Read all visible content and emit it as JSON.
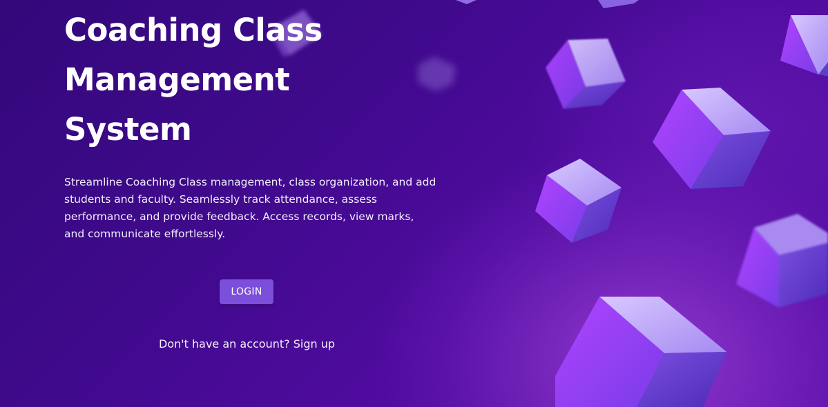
{
  "hero": {
    "title_line1": "Coaching Class",
    "title_line2": "Management",
    "title_line3": "System",
    "description": "Streamline Coaching Class management, class organization, and add students and faculty. Seamlessly track attendance, assess performance, and provide feedback. Access records, view marks, and communicate effortlessly."
  },
  "actions": {
    "login_label": "LOGIN",
    "signup_prompt": "Don't have an account?",
    "signup_link": "Sign up"
  },
  "theme": {
    "background_start": "#33087a",
    "background_end": "#5c10a8",
    "button_color": "#7b4fd9"
  }
}
